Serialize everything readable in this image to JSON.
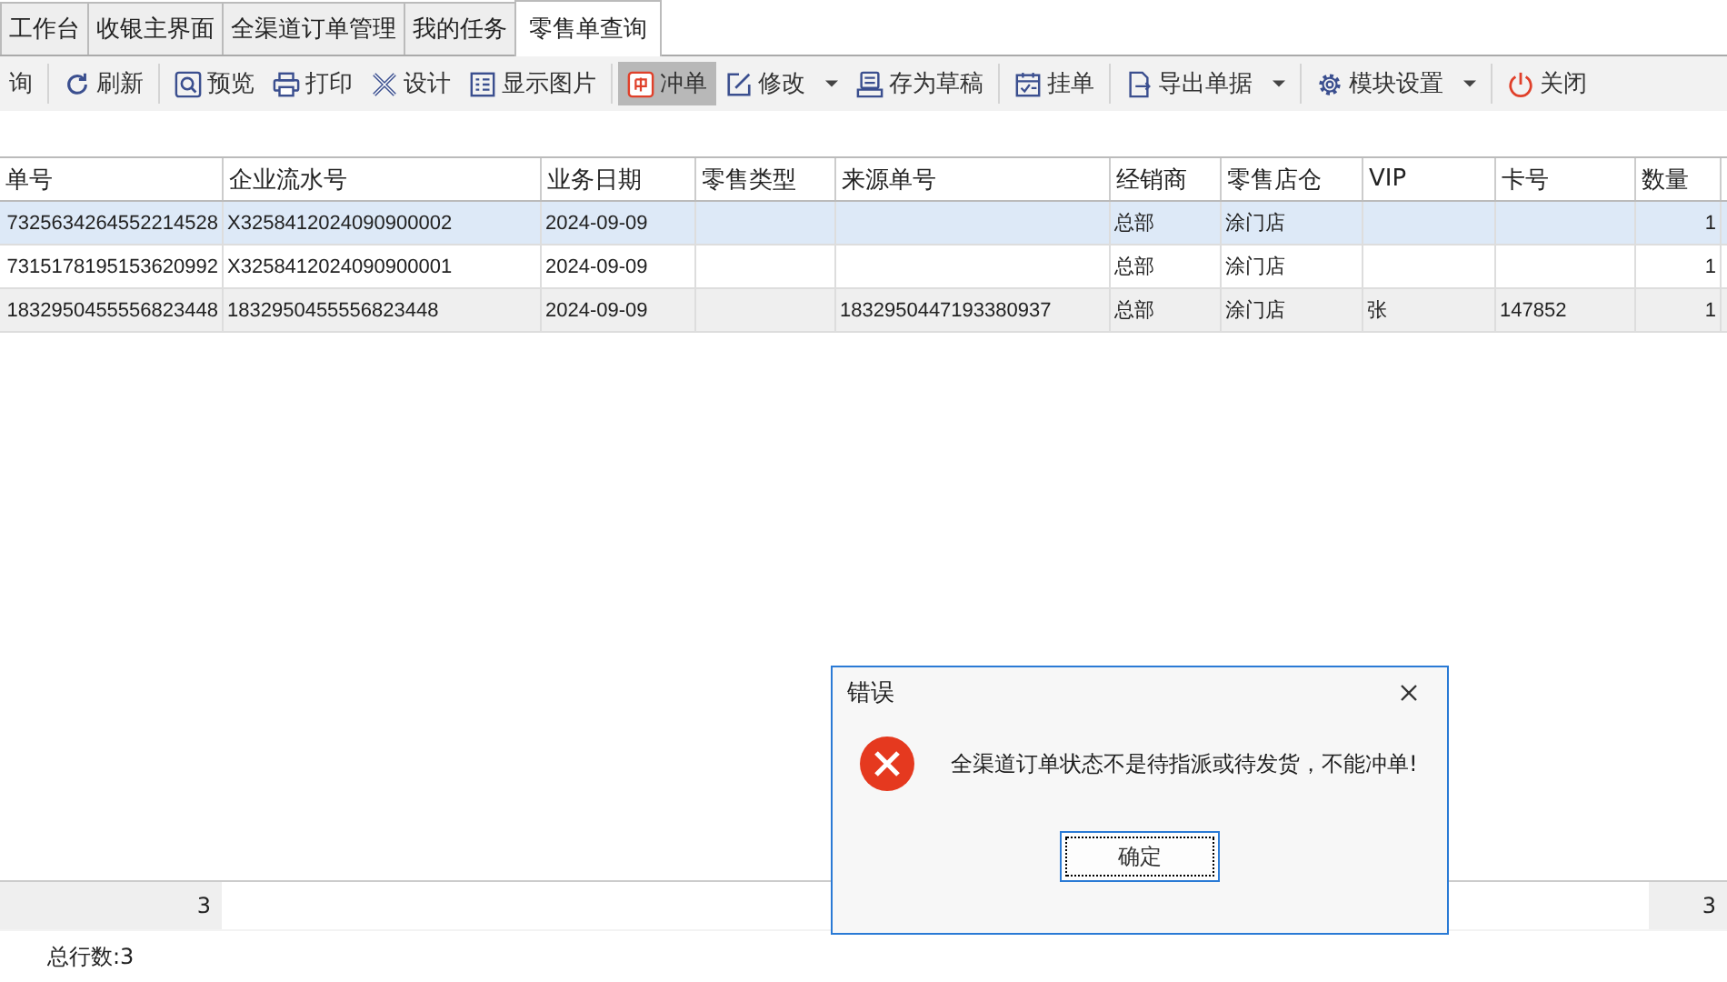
{
  "tabs": [
    {
      "label": "工作台",
      "selected": false
    },
    {
      "label": "收银主界面",
      "selected": false
    },
    {
      "label": "全渠道订单管理",
      "selected": false
    },
    {
      "label": "我的任务",
      "selected": false
    },
    {
      "label": "零售单查询",
      "selected": true
    }
  ],
  "toolbar": [
    {
      "label": "询",
      "kind": "button",
      "pressed": false
    },
    {
      "label": "刷新",
      "kind": "button",
      "pressed": false
    },
    {
      "label": "预览",
      "kind": "button",
      "pressed": false
    },
    {
      "label": "打印",
      "kind": "button",
      "pressed": false
    },
    {
      "label": "设计",
      "kind": "button",
      "pressed": false
    },
    {
      "label": "显示图片",
      "kind": "button",
      "pressed": false
    },
    {
      "label": "冲单",
      "kind": "button",
      "pressed": true
    },
    {
      "label": "修改",
      "kind": "dropdown",
      "pressed": false
    },
    {
      "label": "存为草稿",
      "kind": "button",
      "pressed": false
    },
    {
      "label": "挂单",
      "kind": "button",
      "pressed": false
    },
    {
      "label": "导出单据",
      "kind": "dropdown",
      "pressed": false
    },
    {
      "label": "模块设置",
      "kind": "dropdown",
      "pressed": false
    },
    {
      "label": "关闭",
      "kind": "button",
      "pressed": false
    }
  ],
  "table": {
    "columns": [
      "单号",
      "企业流水号",
      "业务日期",
      "零售类型",
      "来源单号",
      "经销商",
      "零售店仓",
      "VIP",
      "卡号",
      "数量"
    ],
    "rows": [
      {
        "selected": true,
        "cells": [
          "7325634264552214528",
          "X3258412024090900002",
          "2024-09-09",
          "",
          "",
          "总部",
          "涂门店",
          "",
          "",
          "1"
        ]
      },
      {
        "selected": false,
        "cells": [
          "7315178195153620992",
          "X3258412024090900001",
          "2024-09-09",
          "",
          "",
          "总部",
          "涂门店",
          "",
          "",
          "1"
        ]
      },
      {
        "selected": false,
        "cells": [
          "1832950455556823448",
          "1832950455556823448",
          "2024-09-09",
          "",
          "1832950447193380937",
          "总部",
          "涂门店",
          "张",
          "147852",
          "1"
        ]
      }
    ],
    "summary": {
      "first": "3",
      "last": "3"
    }
  },
  "status_bar": "总行数:3",
  "dialog": {
    "title": "错误",
    "message": "全渠道订单状态不是待指派或待发货，不能冲单!",
    "button": "确定"
  }
}
